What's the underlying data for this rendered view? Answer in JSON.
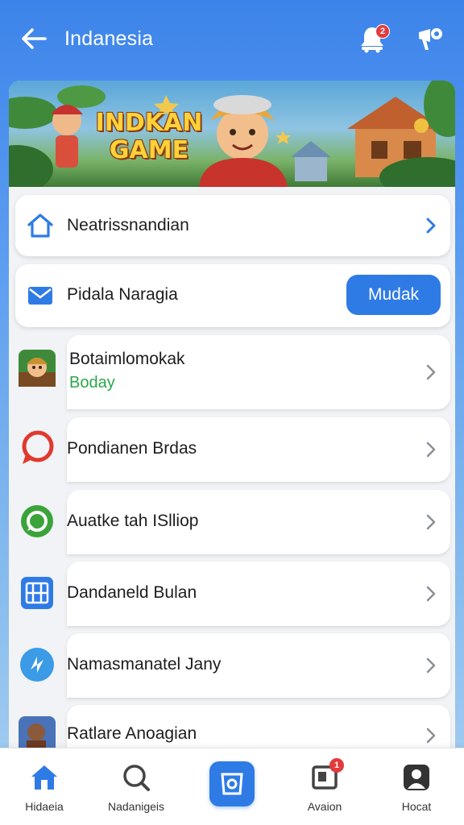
{
  "header": {
    "title": "Indanesia",
    "notification_badge": "2",
    "icons": [
      "back-arrow-icon",
      "bell-icon",
      "megaphone-icon"
    ]
  },
  "banner": {
    "title": "INDKAN GAME"
  },
  "items": [
    {
      "label": "Neatrissnandian",
      "icon": "home-icon"
    },
    {
      "label": "Pidala Naragia",
      "icon": "mail-icon",
      "button": "Mudak"
    }
  ],
  "rows": [
    {
      "label": "Botaimlomokak",
      "sub": "Boday",
      "icon": "game-avatar-icon"
    },
    {
      "label": "Pondianen Brdas",
      "icon": "chat-bubble-icon"
    },
    {
      "label": "Auatke tah ISlliop",
      "icon": "whatsapp-icon"
    },
    {
      "label": "Dandaneld Bulan",
      "icon": "calendar-grid-icon"
    },
    {
      "label": "Namasmanatel Jany",
      "icon": "refresh-icon"
    },
    {
      "label": "Ratlare Anoagian",
      "icon": "game-avatar-icon"
    }
  ],
  "bottom_nav": [
    {
      "label": "Hidaeia",
      "icon": "home-icon"
    },
    {
      "label": "Nadanigeis",
      "icon": "search-icon"
    },
    {
      "label": "",
      "icon": "shield-app-icon"
    },
    {
      "label": "Avaion",
      "icon": "inbox-icon",
      "badge": "1"
    },
    {
      "label": "Hocat",
      "icon": "profile-icon"
    }
  ],
  "colors": {
    "accent": "#2f7be5",
    "header_bg": "#3d84ea",
    "badge": "#e23b3b",
    "success_text": "#2aa84a"
  }
}
